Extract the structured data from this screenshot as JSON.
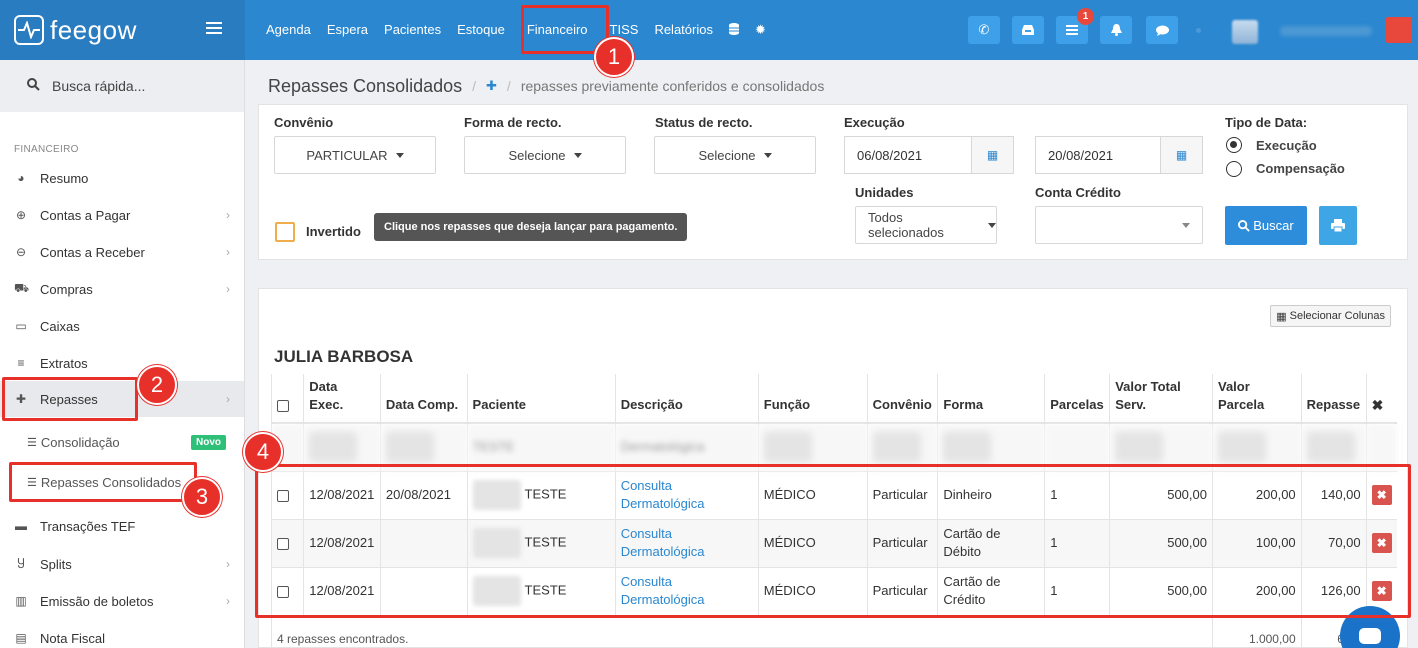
{
  "app": {
    "brand": "feegow",
    "accent": "#2a87d0"
  },
  "nav": {
    "items": [
      "Agenda",
      "Espera",
      "Pacientes",
      "Estoque",
      "Financeiro",
      "TISS",
      "Relatórios"
    ],
    "icons": [
      "database-icon",
      "gear-icon"
    ],
    "notification_count": "1"
  },
  "sidebar": {
    "search": "Busca rápida...",
    "section": "FINANCEIRO",
    "items": [
      {
        "label": "Resumo",
        "icon": "pie-chart-icon"
      },
      {
        "label": "Contas a Pagar",
        "icon": "arrow-up-circle-icon"
      },
      {
        "label": "Contas a Receber",
        "icon": "arrow-down-circle-icon"
      },
      {
        "label": "Compras",
        "icon": "cart-icon"
      },
      {
        "label": "Caixas",
        "icon": "inbox-icon"
      },
      {
        "label": "Extratos",
        "icon": "list-icon"
      },
      {
        "label": "Repasses",
        "icon": "puzzle-icon"
      },
      {
        "label": "Transações TEF",
        "icon": "credit-card-icon"
      },
      {
        "label": "Splits",
        "icon": "split-icon"
      },
      {
        "label": "Emissão de boletos",
        "icon": "barcode-icon"
      },
      {
        "label": "Nota Fiscal",
        "icon": "file-icon"
      }
    ],
    "subitems": [
      {
        "label": "Consolidação",
        "badge": "Novo"
      },
      {
        "label": "Repasses Consolidados"
      }
    ]
  },
  "breadcrumb": {
    "title": "Repasses Consolidados",
    "sub": "repasses previamente conferidos e consolidados"
  },
  "filters": {
    "convenio": {
      "label": "Convênio",
      "value": "PARTICULAR"
    },
    "forma": {
      "label": "Forma de recto.",
      "value": "Selecione"
    },
    "status": {
      "label": "Status de recto.",
      "value": "Selecione"
    },
    "execucao": {
      "label": "Execução",
      "from": "06/08/2021",
      "to": "20/08/2021"
    },
    "tipo": {
      "label": "Tipo de Data:",
      "opt1": "Execução",
      "opt2": "Compensação"
    },
    "unidades": {
      "label": "Unidades",
      "value": "Todos selecionados"
    },
    "conta": {
      "label": "Conta Crédito",
      "value": ""
    },
    "invertido": "Invertido",
    "tooltip": "Clique nos repasses que deseja lançar para pagamento.",
    "buscar": "Buscar"
  },
  "table": {
    "select_columns": "Selecionar Colunas",
    "group": "JULIA BARBOSA",
    "headers": [
      "Data Exec.",
      "Data Comp.",
      "Paciente",
      "Descrição",
      "Função",
      "Convênio",
      "Forma",
      "Parcelas",
      "Valor Total Serv.",
      "Valor Parcela",
      "Repasse"
    ],
    "rows": [
      {
        "exec": "12/08/2021",
        "comp": "20/08/2021",
        "paciente": "TESTE",
        "desc": "Consulta Dermatológica",
        "funcao": "MÉDICO",
        "convenio": "Particular",
        "forma": "Dinheiro",
        "parcelas": "1",
        "total": "500,00",
        "parcela": "200,00",
        "repasse": "140,00"
      },
      {
        "exec": "12/08/2021",
        "comp": "",
        "paciente": "TESTE",
        "desc": "Consulta Dermatológica",
        "funcao": "MÉDICO",
        "convenio": "Particular",
        "forma": "Cartão de Débito",
        "parcelas": "1",
        "total": "500,00",
        "parcela": "100,00",
        "repasse": "70,00"
      },
      {
        "exec": "12/08/2021",
        "comp": "",
        "paciente": "TESTE",
        "desc": "Consulta Dermatológica",
        "funcao": "MÉDICO",
        "convenio": "Particular",
        "forma": "Cartão de Crédito",
        "parcelas": "1",
        "total": "500,00",
        "parcela": "200,00",
        "repasse": "126,00"
      }
    ],
    "blurred": {
      "paciente": "TESTE",
      "desc": "Dermatológica"
    },
    "footer": {
      "count": "4 repasses encontrados.",
      "total_parcela": "1.000,00",
      "total_repasse": "636,"
    }
  },
  "annotations": [
    "1",
    "2",
    "3",
    "4"
  ]
}
